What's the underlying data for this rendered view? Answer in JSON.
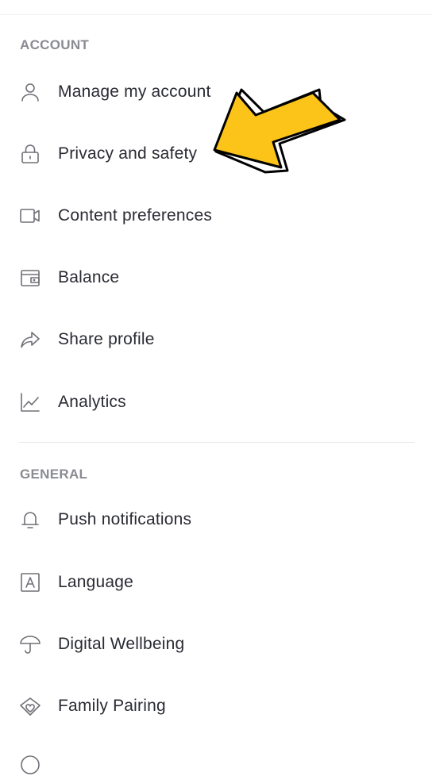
{
  "sections": {
    "account": {
      "header": "ACCOUNT",
      "items": [
        {
          "label": "Manage my account",
          "icon": "person-icon"
        },
        {
          "label": "Privacy and safety",
          "icon": "lock-icon"
        },
        {
          "label": "Content preferences",
          "icon": "video-icon"
        },
        {
          "label": "Balance",
          "icon": "wallet-icon"
        },
        {
          "label": "Share profile",
          "icon": "share-icon"
        },
        {
          "label": "Analytics",
          "icon": "chart-icon"
        }
      ]
    },
    "general": {
      "header": "GENERAL",
      "items": [
        {
          "label": "Push notifications",
          "icon": "bell-icon"
        },
        {
          "label": "Language",
          "icon": "language-icon"
        },
        {
          "label": "Digital Wellbeing",
          "icon": "umbrella-icon"
        },
        {
          "label": "Family Pairing",
          "icon": "family-pairing-icon"
        }
      ]
    }
  },
  "colors": {
    "arrow_fill": "#fcc419",
    "arrow_stroke": "#000000",
    "icon_stroke": "#6f7077",
    "header_text": "#8a8b91"
  }
}
